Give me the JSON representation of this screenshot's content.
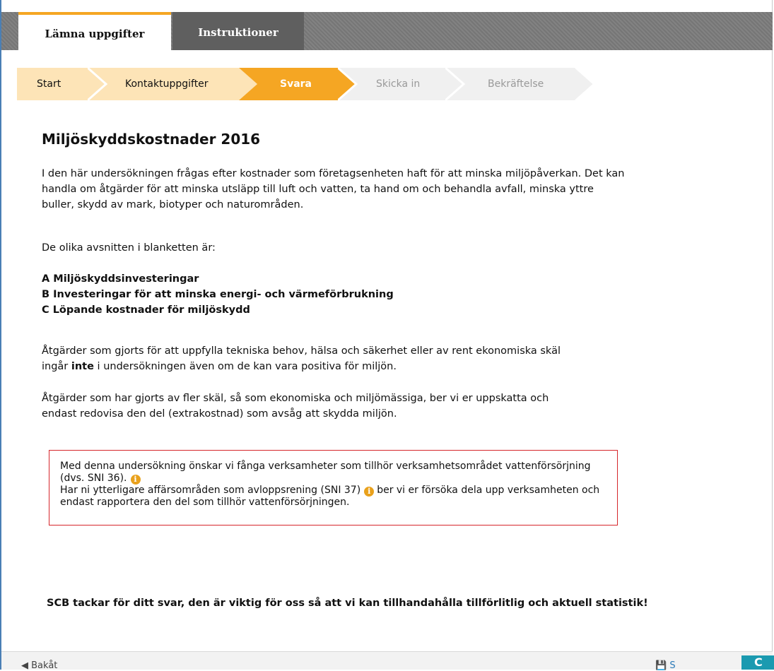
{
  "tabs": {
    "active_label": "Lämna uppgifter",
    "inactive_label": "Instruktioner"
  },
  "stepper": {
    "steps": [
      "Start",
      "Kontaktuppgifter",
      "Svara",
      "Skicka in",
      "Bekräftelse"
    ],
    "current": "Svara"
  },
  "colors": {
    "tab_accent": "#f5a623",
    "step_done": "#fde4b7",
    "step_current": "#f5a623",
    "step_todo": "#f0f0f0",
    "info_border": "#d6262b",
    "info_icon": "#e9a11c",
    "next_button": "#1b9ab0"
  },
  "content": {
    "title": "Miljöskyddskostnader 2016",
    "p1": "I den här undersökningen frågas efter kostnader som företagsenheten haft för att minska miljöpåverkan. Det kan handla om åtgärder för att minska utsläpp till luft och vatten, ta hand om och behandla avfall, minska yttre buller, skydd av mark, biotyper och naturområden.",
    "p2": "De olika avsnitten i blanketten är:",
    "sections": [
      "A Miljöskyddsinvesteringar",
      "B Investeringar för att minska energi- och värmeförbrukning",
      "C Löpande kostnader för miljöskydd"
    ],
    "p3_before": "Åtgärder som gjorts för att uppfylla tekniska behov, hälsa och säkerhet eller av rent ekonomiska skäl ingår ",
    "p3_bold": "inte",
    "p3_after": " i undersökningen även om de kan vara positiva för miljön.",
    "p4": "Åtgärder som har gjorts av fler skäl, så som ekonomiska och miljömässiga, ber vi er uppskatta och endast redovisa den del (extrakostnad) som avsåg att skydda miljön."
  },
  "infobox": {
    "line1": "Med denna undersökning önskar vi fånga verksamheter som tillhör verksamhetsområdet vattenförsörjning (dvs. SNI 36).",
    "line2_before": "Har ni ytterligare affärsområden som avloppsrening (SNI 37)",
    "line2_after": "ber vi er försöka dela upp verksamheten och endast rapportera den del som tillhör vattenförsörjningen.",
    "icon_glyph": "i",
    "icon": "info-icon"
  },
  "thanks": "SCB tackar för ditt svar, den är viktig för oss så att vi kan tillhandahålla tillförlitlig och aktuell statistik!",
  "footer": {
    "back_label": "◀ Bakåt",
    "save_label": "💾 S",
    "next_label": "C"
  }
}
